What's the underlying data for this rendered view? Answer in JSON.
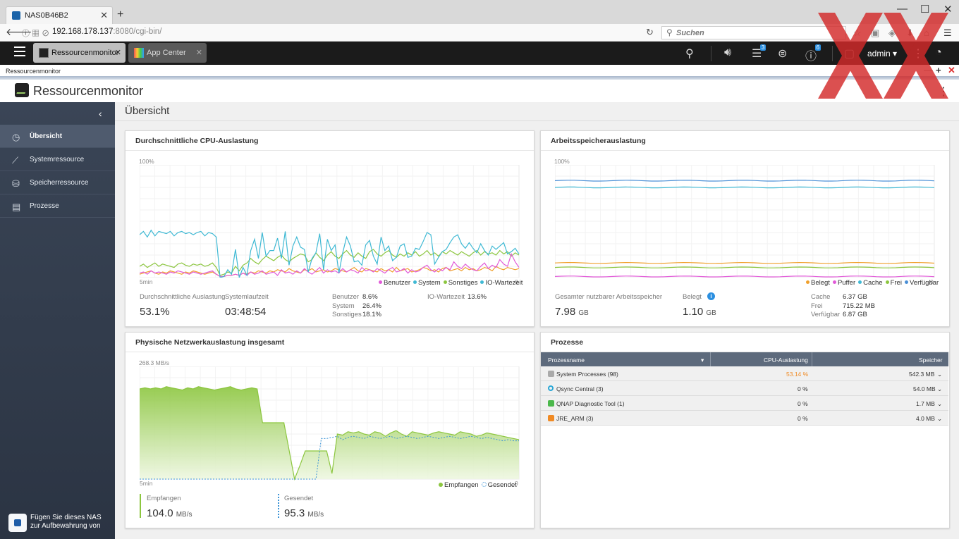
{
  "browser": {
    "tab_title": "NAS0B46B2",
    "url_host": "192.168.178.137",
    "url_rest": ":8080/cgi-bin/",
    "search_placeholder": "Suchen"
  },
  "qts": {
    "tabs": [
      {
        "label": "Ressourcenmonitor"
      },
      {
        "label": "App Center"
      }
    ],
    "user": "admin ▾",
    "badge_tasks": "3",
    "badge_info": "6"
  },
  "window": {
    "title": "Ressourcenmonitor",
    "app_title": "Ressourcenmonitor"
  },
  "sidebar": {
    "items": [
      {
        "label": "Übersicht",
        "icon": "dashboard-icon"
      },
      {
        "label": "Systemressource",
        "icon": "chart-line-icon"
      },
      {
        "label": "Speicherressource",
        "icon": "storage-icon"
      },
      {
        "label": "Prozesse",
        "icon": "list-icon"
      }
    ],
    "nas_text": "Fügen Sie dieses NAS zur Aufbewahrung von"
  },
  "main": {
    "title": "Übersicht"
  },
  "cpu": {
    "title": "Durchschnittliche CPU-Auslastung",
    "ymax": "100%",
    "xmin": "5min",
    "xend": "0",
    "legend": [
      "Benutzer",
      "System",
      "Sonstiges",
      "IO-Wartezeit"
    ],
    "colors": {
      "user": "#e15ad8",
      "system": "#3fb9d4",
      "other": "#8cc63f",
      "io": "#f0a02c"
    },
    "avg_label": "Durchschnittliche Auslastung",
    "avg_value": "53.1%",
    "uptime_label": "Systemlaufzeit",
    "uptime_value": "03:48:54",
    "user_label": "Benutzer",
    "user_value": "8.6%",
    "system_label": "System",
    "system_value": "26.4%",
    "other_label": "Sonstiges",
    "other_value": "18.1%",
    "io_label": "IO-Wartezeit",
    "io_value": "13.6%",
    "series": {
      "system": [
        38,
        41,
        36,
        42,
        37,
        41,
        40,
        39,
        41,
        37,
        40,
        41,
        39,
        40,
        38,
        40,
        41,
        37,
        40,
        39,
        36,
        0,
        1,
        7,
        3,
        25,
        0,
        9,
        2,
        24,
        34,
        17,
        40,
        19,
        24,
        24,
        35,
        17,
        41,
        11,
        28,
        36,
        27,
        25,
        5,
        17,
        22,
        39,
        7,
        34,
        24,
        29,
        4,
        22,
        36,
        28,
        14,
        15,
        11,
        29,
        33,
        19,
        12,
        36,
        24,
        28,
        15,
        18,
        28,
        30,
        18,
        19,
        26,
        25,
        32,
        40,
        38,
        12,
        18,
        23,
        25,
        31,
        36,
        38,
        30,
        26,
        31,
        26,
        22,
        30,
        24,
        20,
        28,
        25,
        28,
        31,
        21,
        23,
        26,
        21
      ],
      "other": [
        10,
        12,
        9,
        11,
        13,
        10,
        12,
        11,
        10,
        9,
        12,
        13,
        11,
        10,
        12,
        11,
        12,
        10,
        11,
        13,
        9,
        2,
        3,
        5,
        4,
        10,
        6,
        11,
        13,
        17,
        14,
        12,
        16,
        19,
        17,
        15,
        18,
        20,
        16,
        14,
        17,
        19,
        21,
        20,
        14,
        16,
        22,
        18,
        15,
        20,
        23,
        19,
        17,
        21,
        24,
        20,
        18,
        22,
        19,
        17,
        23,
        25,
        21,
        19,
        22,
        24,
        20,
        18,
        21,
        19,
        22,
        20,
        23,
        19,
        21,
        24,
        20,
        22,
        19,
        23,
        21,
        24,
        22,
        20,
        23,
        21,
        19,
        22,
        24,
        20,
        23,
        21,
        22,
        20,
        24,
        21,
        23,
        19,
        22,
        20
      ],
      "user": [
        4,
        5,
        3,
        6,
        4,
        5,
        4,
        3,
        5,
        4,
        6,
        5,
        4,
        3,
        5,
        4,
        3,
        4,
        5,
        6,
        3,
        1,
        1,
        2,
        2,
        3,
        2,
        4,
        2,
        5,
        3,
        4,
        6,
        3,
        4,
        5,
        2,
        7,
        4,
        5,
        3,
        6,
        4,
        8,
        5,
        3,
        6,
        9,
        4,
        7,
        5,
        6,
        4,
        8,
        5,
        7,
        6,
        4,
        9,
        6,
        7,
        5,
        8,
        6,
        4,
        7,
        9,
        5,
        6,
        8,
        4,
        7,
        5,
        6,
        9,
        11,
        7,
        5,
        8,
        6,
        9,
        7,
        14,
        10,
        8,
        12,
        9,
        7,
        6,
        10,
        13,
        8,
        11,
        9,
        16,
        12,
        10,
        21,
        14,
        9
      ],
      "io": [
        3,
        4,
        5,
        6,
        4,
        3,
        5,
        4,
        6,
        5,
        4,
        3,
        5,
        4,
        6,
        5,
        4,
        3,
        4,
        5,
        3,
        1,
        1,
        2,
        2,
        3,
        2,
        4,
        3,
        5,
        4,
        6,
        5,
        4,
        6,
        5,
        7,
        6,
        5,
        8,
        6,
        5,
        4,
        7,
        6,
        8,
        5,
        6,
        7,
        5,
        6,
        8,
        7,
        6,
        5,
        7,
        9,
        6,
        5,
        8,
        7,
        6,
        5,
        8,
        6,
        7,
        5,
        9,
        6,
        7,
        8,
        5,
        6,
        7,
        9,
        8,
        6,
        7,
        5,
        8,
        9,
        6,
        7,
        8,
        6,
        9,
        7,
        8,
        6,
        7,
        9,
        8,
        6,
        10,
        8,
        7,
        9,
        8,
        7,
        8
      ]
    }
  },
  "mem": {
    "title": "Arbeitsspeicherauslastung",
    "ymax": "100%",
    "xend": "0",
    "legend": [
      "Belegt",
      "Puffer",
      "Cache",
      "Frei",
      "Verfügbar"
    ],
    "colors": {
      "used": "#f0a02c",
      "buffer": "#e15ad8",
      "cache": "#3fb9d4",
      "free": "#8cc63f",
      "avail": "#4a8fd6"
    },
    "total_label": "Gesamter nutzbarer Arbeitsspeicher",
    "total_value": "7.98",
    "total_unit": "GB",
    "used_label": "Belegt",
    "used_value": "1.10",
    "used_unit": "GB",
    "cache_label": "Cache",
    "cache_value": "6.37 GB",
    "free_label": "Frei",
    "free_value": "715.22 MB",
    "avail_label": "Verfügbar",
    "avail_value": "6.87 GB",
    "series": {
      "used": 13,
      "buffer": 1,
      "cache": 80,
      "free": 9,
      "avail": 86
    }
  },
  "net": {
    "title": "Physische Netzwerkauslastung insgesamt",
    "ymax": "268.3 MB/s",
    "xmin": "5min",
    "xend": "0",
    "legend": [
      "Empfangen",
      "Gesendet"
    ],
    "colors": {
      "rx": "#8cc63f",
      "tx": "#3a93d6"
    },
    "rx_label": "Empfangen",
    "rx_value": "104.0",
    "rx_unit": "MB/s",
    "tx_label": "Gesendet",
    "tx_value": "95.3",
    "tx_unit": "MB/s",
    "rx_series": [
      80,
      81,
      80,
      81,
      80,
      82,
      81,
      80,
      79,
      81,
      80,
      82,
      81,
      80,
      79,
      80,
      81,
      82,
      80,
      79,
      80,
      81,
      80,
      50,
      50,
      50,
      50,
      50,
      25,
      0,
      12,
      25,
      25,
      25,
      25,
      25,
      5,
      40,
      39,
      42,
      41,
      42,
      40,
      39,
      42,
      41,
      38,
      41,
      43,
      40,
      38,
      42,
      41,
      40,
      39,
      41,
      42,
      41,
      40,
      39,
      42,
      41,
      40,
      38,
      39,
      41,
      40,
      39,
      38,
      37,
      36,
      35
    ],
    "tx_series": [
      0,
      0,
      0,
      0,
      0,
      0,
      0,
      0,
      0,
      0,
      0,
      0,
      0,
      0,
      0,
      0,
      0,
      0,
      0,
      0,
      0,
      0,
      0,
      0,
      0,
      0,
      0,
      0,
      0,
      0,
      0,
      0,
      0,
      0,
      36,
      36,
      37,
      38,
      35,
      37,
      38,
      37,
      36,
      38,
      37,
      36,
      37,
      38,
      36,
      37,
      38,
      37,
      36,
      37,
      38,
      37,
      36,
      37,
      38,
      37,
      36,
      37,
      38,
      37,
      36,
      37,
      36,
      35,
      34,
      35,
      34,
      34
    ]
  },
  "proc": {
    "title": "Prozesse",
    "col_name": "Prozessname",
    "col_cpu": "CPU-Auslastung",
    "col_mem": "Speicher",
    "rows": [
      {
        "name": "System Processes (98)",
        "cpu": "53.14 %",
        "mem": "542.3 MB",
        "icon": "system-process-icon",
        "color": "#999999"
      },
      {
        "name": "Qsync Central (3)",
        "cpu": "0 %",
        "mem": "54.0 MB",
        "icon": "qsync-icon",
        "color": "#2aa7d6"
      },
      {
        "name": "QNAP Diagnostic Tool (1)",
        "cpu": "0 %",
        "mem": "1.7 MB",
        "icon": "diagnostic-tool-icon",
        "color": "#4bb84b"
      },
      {
        "name": "JRE_ARM (3)",
        "cpu": "0 %",
        "mem": "4.0 MB",
        "icon": "java-icon",
        "color": "#f08a24"
      }
    ]
  },
  "chart_data": [
    {
      "type": "line",
      "title": "Durchschnittliche CPU-Auslastung",
      "ylim": [
        0,
        100
      ],
      "series_names": [
        "Benutzer",
        "System",
        "Sonstiges",
        "IO-Wartezeit"
      ]
    },
    {
      "type": "line",
      "title": "Arbeitsspeicherauslastung",
      "ylim": [
        0,
        100
      ],
      "series_names": [
        "Belegt",
        "Puffer",
        "Cache",
        "Frei",
        "Verfügbar"
      ]
    },
    {
      "type": "area",
      "title": "Physische Netzwerkauslastung insgesamt",
      "ylim": [
        0,
        268.3
      ],
      "series_names": [
        "Empfangen",
        "Gesendet"
      ]
    }
  ]
}
